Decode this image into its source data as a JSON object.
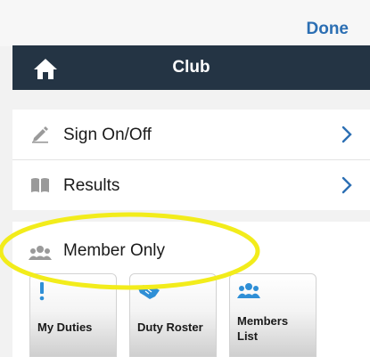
{
  "header": {
    "done_label": "Done"
  },
  "nav": {
    "title": "Club",
    "home_icon": "home-icon"
  },
  "list": {
    "items": [
      {
        "label": "Sign On/Off",
        "icon": "pencil-icon"
      },
      {
        "label": "Results",
        "icon": "book-icon"
      }
    ]
  },
  "section": {
    "title": "Member Only",
    "icon": "group-icon"
  },
  "tiles": [
    {
      "label": "My Duties",
      "icon": "exclamation-icon"
    },
    {
      "label": "Duty Roster",
      "icon": "handshake-icon"
    },
    {
      "label_line1": "Members",
      "label_line2": "List",
      "icon": "group-icon"
    }
  ],
  "colors": {
    "accent": "#2c6fb3",
    "navbar": "#243444",
    "tile_icon": "#2f8fd6",
    "highlight": "#f2ec1b"
  }
}
